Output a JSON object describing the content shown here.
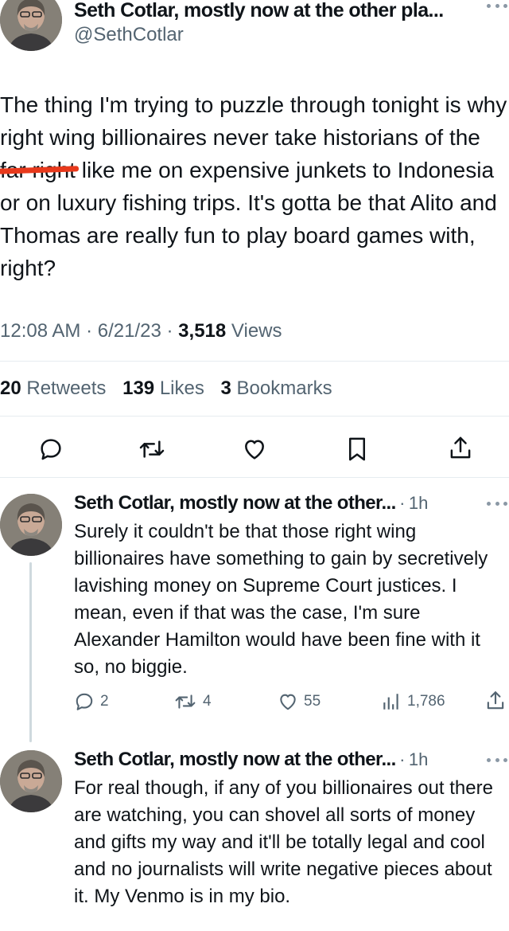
{
  "main_tweet": {
    "author_name": "Seth Cotlar, mostly now at the other pla...",
    "handle": "@SethCotlar",
    "text_before": "The thing I'm trying to puzzle through tonight is why right wing billionaires never take historians of the ",
    "text_redacted": "far right",
    "text_after": " like me on expensive junkets to Indonesia or on luxury fishing trips. It's gotta be that Alito and Thomas are really fun to play board games with, right?",
    "time": "12:08 AM",
    "date": "6/21/23",
    "views_count": "3,518",
    "views_label": "Views",
    "separator": "·",
    "retweets_count": "20",
    "retweets_label": "Retweets",
    "likes_count": "139",
    "likes_label": "Likes",
    "bookmarks_count": "3",
    "bookmarks_label": "Bookmarks",
    "actions": [
      "reply-icon",
      "retweet-icon",
      "like-icon",
      "bookmark-icon",
      "share-icon"
    ]
  },
  "replies": [
    {
      "author_name": "Seth Cotlar, mostly now at the other...",
      "separator": "·",
      "time": "1h",
      "text": "Surely it couldn't be that those right wing billionaires have something to gain by secretively lavishing money on Supreme Court justices. I mean, even if that was the case, I'm sure Alexander Hamilton would have been fine with it so, no biggie.",
      "replies": "2",
      "retweets": "4",
      "likes": "55",
      "views": "1,786"
    },
    {
      "author_name": "Seth Cotlar, mostly now at the other...",
      "separator": "·",
      "time": "1h",
      "text": "For real though, if any of you billionaires out there are watching, you can shovel all sorts of money and gifts my way and it'll be totally legal and cool and no journalists will write negative pieces about it. My Venmo is in my bio."
    }
  ],
  "colors": {
    "text": "#0f1419",
    "secondary": "#536471",
    "divider": "#e6ecf0",
    "redaction": "#e8391c"
  }
}
